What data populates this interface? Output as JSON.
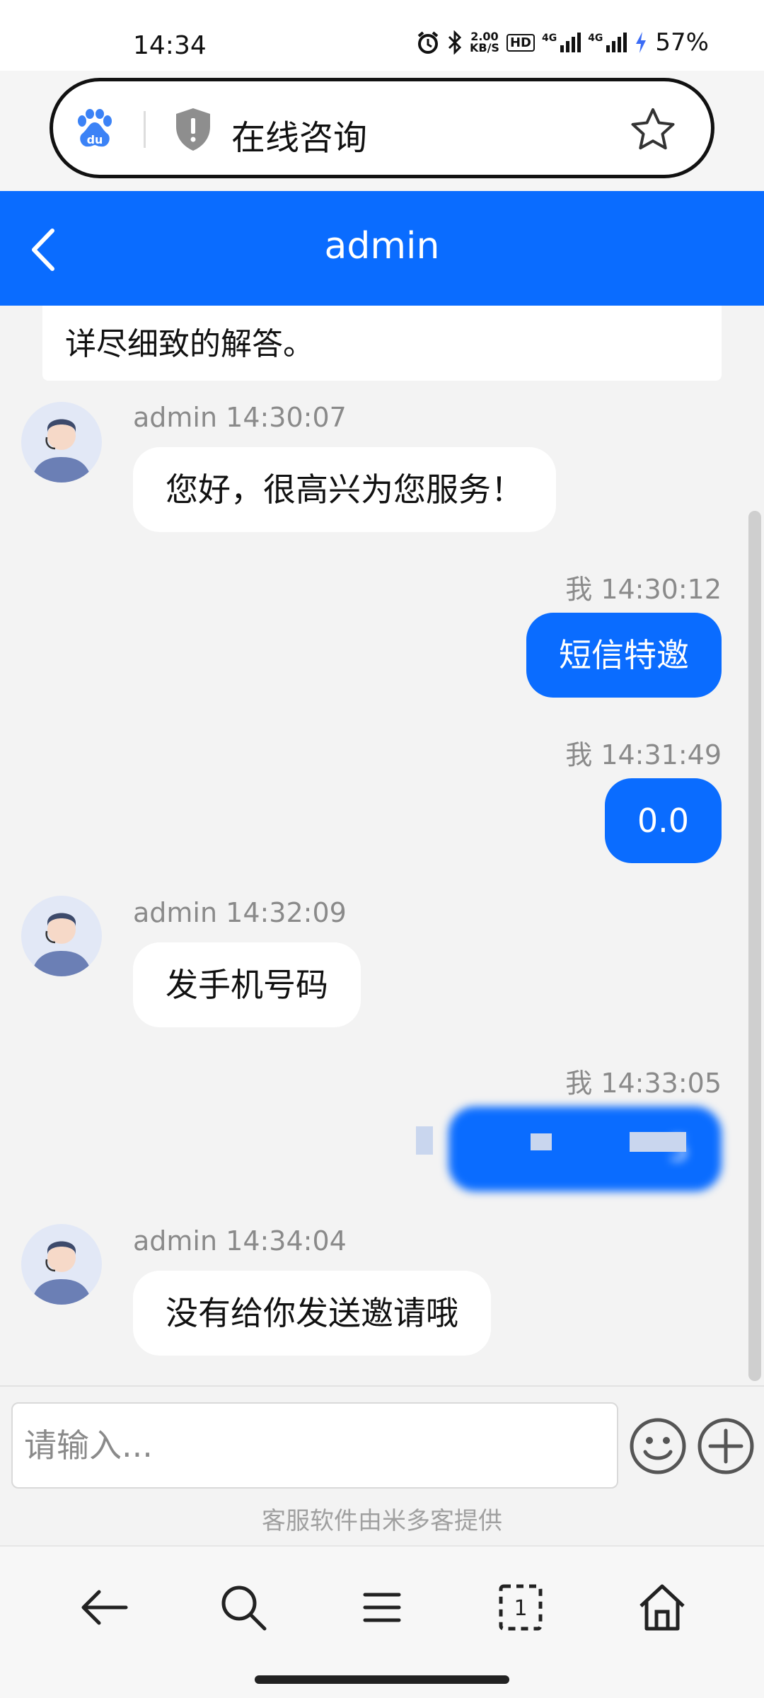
{
  "status_bar": {
    "time": "14:34",
    "net_speed_value": "2.00",
    "net_speed_unit": "KB/S",
    "hd_label": "HD",
    "signal1_label": "4G",
    "signal2_label": "4G",
    "battery": "57%"
  },
  "browser": {
    "page_title": "在线咨询"
  },
  "header": {
    "title": "admin"
  },
  "chat": {
    "previous_text": "详尽细致的解答。",
    "messages": [
      {
        "side": "left",
        "meta": "admin 14:30:07",
        "text": "您好，很高兴为您服务！"
      },
      {
        "side": "right",
        "meta": "我 14:30:12",
        "text": "短信特邀"
      },
      {
        "side": "right",
        "meta": "我 14:31:49",
        "text": "0.0"
      },
      {
        "side": "left",
        "meta": "admin 14:32:09",
        "text": "发手机号码"
      },
      {
        "side": "right",
        "meta": "我 14:33:05",
        "text": "5"
      },
      {
        "side": "left",
        "meta": "admin 14:34:04",
        "text": "没有给你发送邀请哦"
      }
    ]
  },
  "input": {
    "placeholder": "请输入...",
    "provider_text": "客服软件由米多客提供"
  },
  "colors": {
    "primary": "#0a6cff",
    "bubble_left": "#ffffff",
    "background": "#f3f3f3"
  }
}
